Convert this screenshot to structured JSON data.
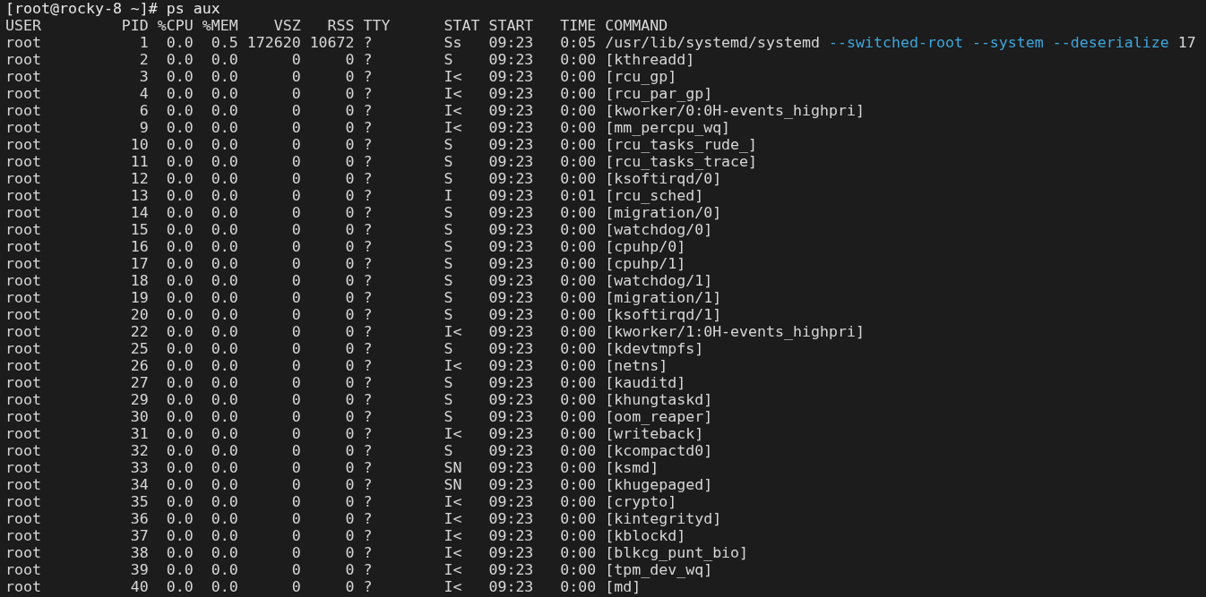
{
  "prompt": "[root@rocky-8 ~]# ps aux",
  "columns": [
    "USER",
    "PID",
    "%CPU",
    "%MEM",
    "VSZ",
    "RSS",
    "TTY",
    "STAT",
    "START",
    "TIME",
    "COMMAND"
  ],
  "rows": [
    {
      "user": "root",
      "pid": "1",
      "cpu": "0.0",
      "mem": "0.5",
      "vsz": "172620",
      "rss": "10672",
      "tty": "?",
      "stat": "Ss",
      "start": "09:23",
      "time": "0:05",
      "command": "/usr/lib/systemd/systemd",
      "args": [
        {
          "text": "--switched-root",
          "kind": "option"
        },
        {
          "text": "--system",
          "kind": "option"
        },
        {
          "text": "--deserialize",
          "kind": "option"
        },
        {
          "text": "17",
          "kind": "plain"
        }
      ]
    },
    {
      "user": "root",
      "pid": "2",
      "cpu": "0.0",
      "mem": "0.0",
      "vsz": "0",
      "rss": "0",
      "tty": "?",
      "stat": "S",
      "start": "09:23",
      "time": "0:00",
      "command": "[kthreadd]"
    },
    {
      "user": "root",
      "pid": "3",
      "cpu": "0.0",
      "mem": "0.0",
      "vsz": "0",
      "rss": "0",
      "tty": "?",
      "stat": "I<",
      "start": "09:23",
      "time": "0:00",
      "command": "[rcu_gp]"
    },
    {
      "user": "root",
      "pid": "4",
      "cpu": "0.0",
      "mem": "0.0",
      "vsz": "0",
      "rss": "0",
      "tty": "?",
      "stat": "I<",
      "start": "09:23",
      "time": "0:00",
      "command": "[rcu_par_gp]"
    },
    {
      "user": "root",
      "pid": "6",
      "cpu": "0.0",
      "mem": "0.0",
      "vsz": "0",
      "rss": "0",
      "tty": "?",
      "stat": "I<",
      "start": "09:23",
      "time": "0:00",
      "command": "[kworker/0:0H-events_highpri]"
    },
    {
      "user": "root",
      "pid": "9",
      "cpu": "0.0",
      "mem": "0.0",
      "vsz": "0",
      "rss": "0",
      "tty": "?",
      "stat": "I<",
      "start": "09:23",
      "time": "0:00",
      "command": "[mm_percpu_wq]"
    },
    {
      "user": "root",
      "pid": "10",
      "cpu": "0.0",
      "mem": "0.0",
      "vsz": "0",
      "rss": "0",
      "tty": "?",
      "stat": "S",
      "start": "09:23",
      "time": "0:00",
      "command": "[rcu_tasks_rude_]"
    },
    {
      "user": "root",
      "pid": "11",
      "cpu": "0.0",
      "mem": "0.0",
      "vsz": "0",
      "rss": "0",
      "tty": "?",
      "stat": "S",
      "start": "09:23",
      "time": "0:00",
      "command": "[rcu_tasks_trace]"
    },
    {
      "user": "root",
      "pid": "12",
      "cpu": "0.0",
      "mem": "0.0",
      "vsz": "0",
      "rss": "0",
      "tty": "?",
      "stat": "S",
      "start": "09:23",
      "time": "0:00",
      "command": "[ksoftirqd/0]"
    },
    {
      "user": "root",
      "pid": "13",
      "cpu": "0.0",
      "mem": "0.0",
      "vsz": "0",
      "rss": "0",
      "tty": "?",
      "stat": "I",
      "start": "09:23",
      "time": "0:01",
      "command": "[rcu_sched]"
    },
    {
      "user": "root",
      "pid": "14",
      "cpu": "0.0",
      "mem": "0.0",
      "vsz": "0",
      "rss": "0",
      "tty": "?",
      "stat": "S",
      "start": "09:23",
      "time": "0:00",
      "command": "[migration/0]"
    },
    {
      "user": "root",
      "pid": "15",
      "cpu": "0.0",
      "mem": "0.0",
      "vsz": "0",
      "rss": "0",
      "tty": "?",
      "stat": "S",
      "start": "09:23",
      "time": "0:00",
      "command": "[watchdog/0]"
    },
    {
      "user": "root",
      "pid": "16",
      "cpu": "0.0",
      "mem": "0.0",
      "vsz": "0",
      "rss": "0",
      "tty": "?",
      "stat": "S",
      "start": "09:23",
      "time": "0:00",
      "command": "[cpuhp/0]"
    },
    {
      "user": "root",
      "pid": "17",
      "cpu": "0.0",
      "mem": "0.0",
      "vsz": "0",
      "rss": "0",
      "tty": "?",
      "stat": "S",
      "start": "09:23",
      "time": "0:00",
      "command": "[cpuhp/1]"
    },
    {
      "user": "root",
      "pid": "18",
      "cpu": "0.0",
      "mem": "0.0",
      "vsz": "0",
      "rss": "0",
      "tty": "?",
      "stat": "S",
      "start": "09:23",
      "time": "0:00",
      "command": "[watchdog/1]"
    },
    {
      "user": "root",
      "pid": "19",
      "cpu": "0.0",
      "mem": "0.0",
      "vsz": "0",
      "rss": "0",
      "tty": "?",
      "stat": "S",
      "start": "09:23",
      "time": "0:00",
      "command": "[migration/1]"
    },
    {
      "user": "root",
      "pid": "20",
      "cpu": "0.0",
      "mem": "0.0",
      "vsz": "0",
      "rss": "0",
      "tty": "?",
      "stat": "S",
      "start": "09:23",
      "time": "0:00",
      "command": "[ksoftirqd/1]"
    },
    {
      "user": "root",
      "pid": "22",
      "cpu": "0.0",
      "mem": "0.0",
      "vsz": "0",
      "rss": "0",
      "tty": "?",
      "stat": "I<",
      "start": "09:23",
      "time": "0:00",
      "command": "[kworker/1:0H-events_highpri]"
    },
    {
      "user": "root",
      "pid": "25",
      "cpu": "0.0",
      "mem": "0.0",
      "vsz": "0",
      "rss": "0",
      "tty": "?",
      "stat": "S",
      "start": "09:23",
      "time": "0:00",
      "command": "[kdevtmpfs]"
    },
    {
      "user": "root",
      "pid": "26",
      "cpu": "0.0",
      "mem": "0.0",
      "vsz": "0",
      "rss": "0",
      "tty": "?",
      "stat": "I<",
      "start": "09:23",
      "time": "0:00",
      "command": "[netns]"
    },
    {
      "user": "root",
      "pid": "27",
      "cpu": "0.0",
      "mem": "0.0",
      "vsz": "0",
      "rss": "0",
      "tty": "?",
      "stat": "S",
      "start": "09:23",
      "time": "0:00",
      "command": "[kauditd]"
    },
    {
      "user": "root",
      "pid": "29",
      "cpu": "0.0",
      "mem": "0.0",
      "vsz": "0",
      "rss": "0",
      "tty": "?",
      "stat": "S",
      "start": "09:23",
      "time": "0:00",
      "command": "[khungtaskd]"
    },
    {
      "user": "root",
      "pid": "30",
      "cpu": "0.0",
      "mem": "0.0",
      "vsz": "0",
      "rss": "0",
      "tty": "?",
      "stat": "S",
      "start": "09:23",
      "time": "0:00",
      "command": "[oom_reaper]"
    },
    {
      "user": "root",
      "pid": "31",
      "cpu": "0.0",
      "mem": "0.0",
      "vsz": "0",
      "rss": "0",
      "tty": "?",
      "stat": "I<",
      "start": "09:23",
      "time": "0:00",
      "command": "[writeback]"
    },
    {
      "user": "root",
      "pid": "32",
      "cpu": "0.0",
      "mem": "0.0",
      "vsz": "0",
      "rss": "0",
      "tty": "?",
      "stat": "S",
      "start": "09:23",
      "time": "0:00",
      "command": "[kcompactd0]"
    },
    {
      "user": "root",
      "pid": "33",
      "cpu": "0.0",
      "mem": "0.0",
      "vsz": "0",
      "rss": "0",
      "tty": "?",
      "stat": "SN",
      "start": "09:23",
      "time": "0:00",
      "command": "[ksmd]"
    },
    {
      "user": "root",
      "pid": "34",
      "cpu": "0.0",
      "mem": "0.0",
      "vsz": "0",
      "rss": "0",
      "tty": "?",
      "stat": "SN",
      "start": "09:23",
      "time": "0:00",
      "command": "[khugepaged]"
    },
    {
      "user": "root",
      "pid": "35",
      "cpu": "0.0",
      "mem": "0.0",
      "vsz": "0",
      "rss": "0",
      "tty": "?",
      "stat": "I<",
      "start": "09:23",
      "time": "0:00",
      "command": "[crypto]"
    },
    {
      "user": "root",
      "pid": "36",
      "cpu": "0.0",
      "mem": "0.0",
      "vsz": "0",
      "rss": "0",
      "tty": "?",
      "stat": "I<",
      "start": "09:23",
      "time": "0:00",
      "command": "[kintegrityd]"
    },
    {
      "user": "root",
      "pid": "37",
      "cpu": "0.0",
      "mem": "0.0",
      "vsz": "0",
      "rss": "0",
      "tty": "?",
      "stat": "I<",
      "start": "09:23",
      "time": "0:00",
      "command": "[kblockd]"
    },
    {
      "user": "root",
      "pid": "38",
      "cpu": "0.0",
      "mem": "0.0",
      "vsz": "0",
      "rss": "0",
      "tty": "?",
      "stat": "I<",
      "start": "09:23",
      "time": "0:00",
      "command": "[blkcg_punt_bio]"
    },
    {
      "user": "root",
      "pid": "39",
      "cpu": "0.0",
      "mem": "0.0",
      "vsz": "0",
      "rss": "0",
      "tty": "?",
      "stat": "I<",
      "start": "09:23",
      "time": "0:00",
      "command": "[tpm_dev_wq]"
    },
    {
      "user": "root",
      "pid": "40",
      "cpu": "0.0",
      "mem": "0.0",
      "vsz": "0",
      "rss": "0",
      "tty": "?",
      "stat": "I<",
      "start": "09:23",
      "time": "0:00",
      "command": "[md]"
    }
  ]
}
